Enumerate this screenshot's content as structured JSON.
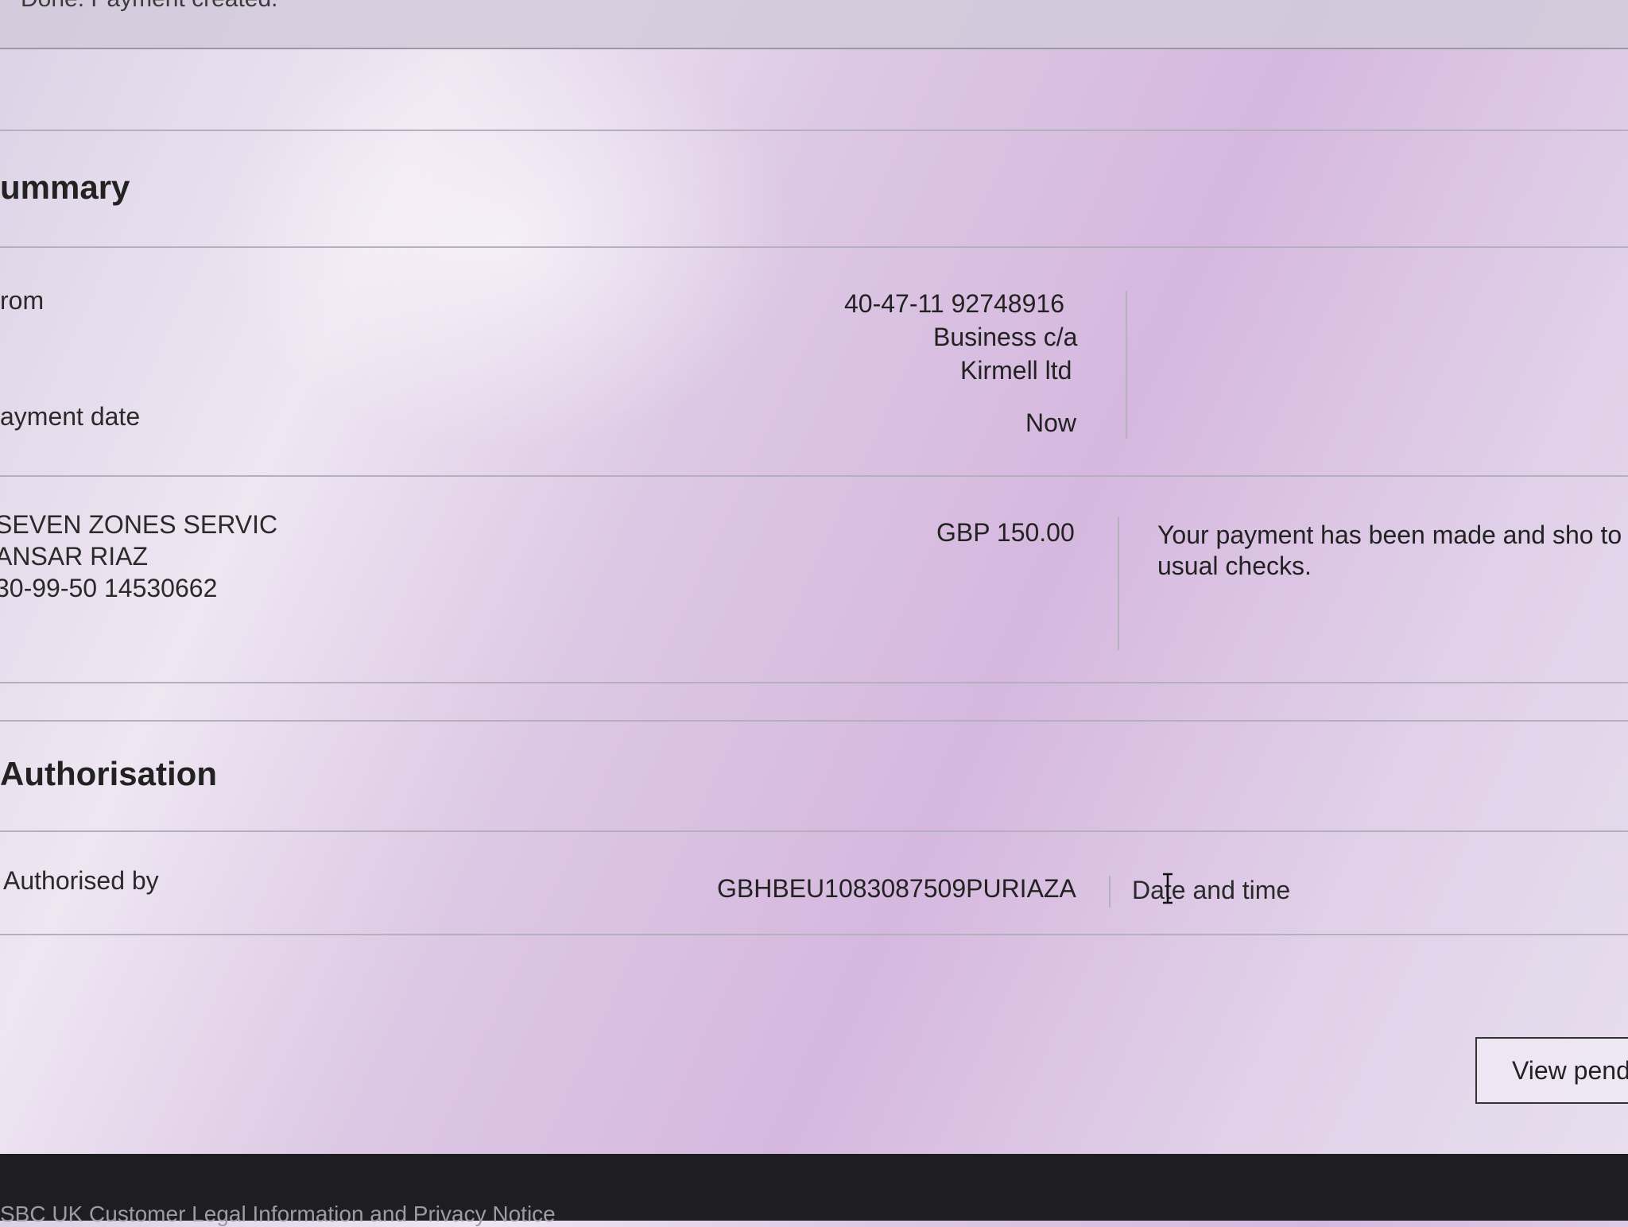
{
  "status": {
    "message": "Done. Payment created."
  },
  "summary": {
    "title": "ummary",
    "from_label": "rom",
    "from_account": "40-47-11 92748916",
    "from_account_name": "Business c/a",
    "from_company": "Kirmell ltd",
    "payment_date_label": "ayment date",
    "payment_date_value": "Now"
  },
  "payee": {
    "name": "SEVEN ZONES SERVIC",
    "reference": "ANSAR RIAZ",
    "account": "30-99-50 14530662",
    "amount": "GBP 150.00",
    "message": "Your payment has been made and sho to our usual checks."
  },
  "authorisation": {
    "title": "Authorisation",
    "authorised_by_label": "Authorised by",
    "authorised_by_value": "GBHBEU1083087509PURIAZA",
    "date_time_label": "Date and time"
  },
  "actions": {
    "view_pending_label": "View pend"
  },
  "footer": {
    "text": "SBC UK Customer Legal Information and Privacy Notice"
  },
  "icons": {
    "cursor": "text-cursor-icon"
  }
}
